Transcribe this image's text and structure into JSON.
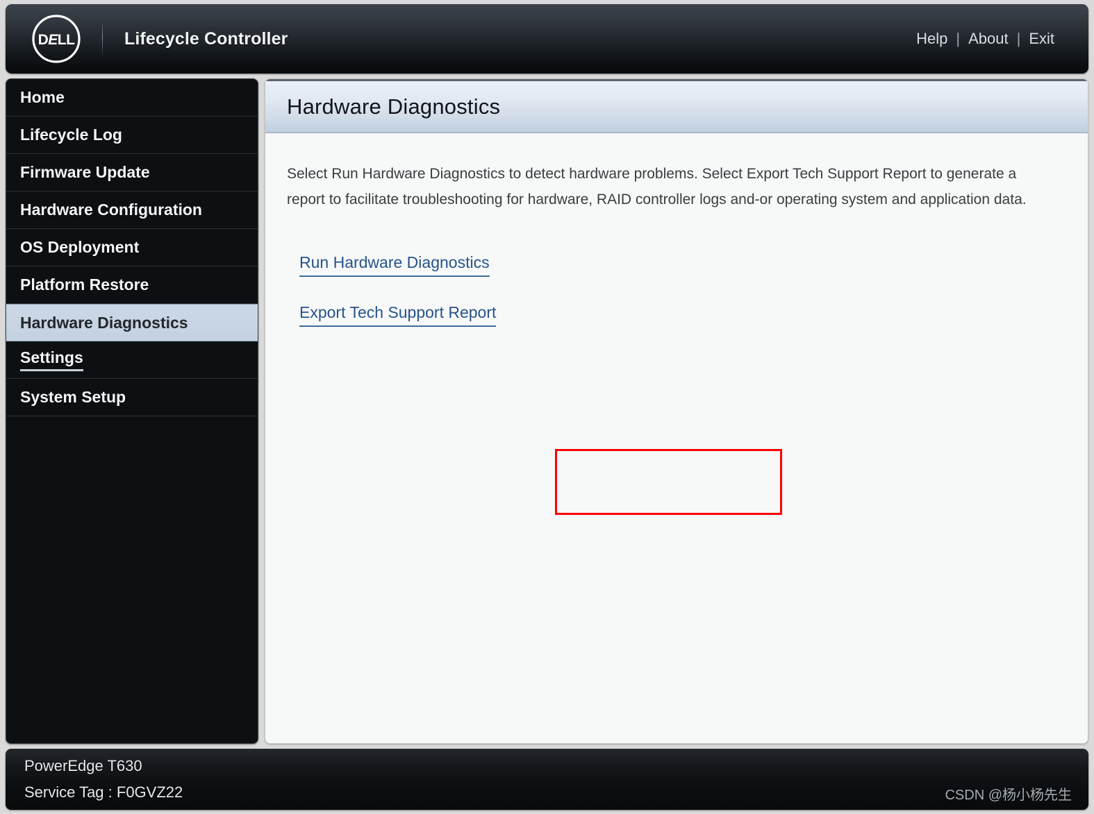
{
  "header": {
    "logo_alt": "DELL",
    "app_title": "Lifecycle Controller",
    "links": [
      {
        "label": "Help"
      },
      {
        "label": "About"
      },
      {
        "label": "Exit"
      }
    ],
    "separator": "|"
  },
  "sidebar": {
    "items": [
      {
        "label": "Home",
        "selected": false,
        "underlined": false
      },
      {
        "label": "Lifecycle Log",
        "selected": false,
        "underlined": false
      },
      {
        "label": "Firmware Update",
        "selected": false,
        "underlined": false
      },
      {
        "label": "Hardware Configuration",
        "selected": false,
        "underlined": false
      },
      {
        "label": "OS Deployment",
        "selected": false,
        "underlined": false
      },
      {
        "label": "Platform Restore",
        "selected": false,
        "underlined": false
      },
      {
        "label": "Hardware Diagnostics",
        "selected": true,
        "underlined": false
      },
      {
        "label": "Settings",
        "selected": false,
        "underlined": true
      },
      {
        "label": "System Setup",
        "selected": false,
        "underlined": false
      }
    ]
  },
  "main": {
    "page_title": "Hardware Diagnostics",
    "description": "Select Run Hardware Diagnostics to detect hardware problems. Select Export Tech Support Report to generate a report to facilitate troubleshooting for hardware, RAID controller logs and-or operating system and application data.",
    "actions": [
      {
        "label": "Run Hardware Diagnostics"
      },
      {
        "label": "Export Tech Support Report"
      }
    ]
  },
  "annotation": {
    "highlight_color": "#fe0000",
    "target_label": "Export Tech Support Report"
  },
  "footer": {
    "model": "PowerEdge T630",
    "service_tag": "Service Tag : F0GVZ22",
    "watermark": "CSDN @杨小杨先生"
  },
  "colors": {
    "link": "#27548a",
    "selected_nav_bg": "#c8d5e4",
    "header_bg": "#23282e",
    "highlight": "#fe0000"
  }
}
